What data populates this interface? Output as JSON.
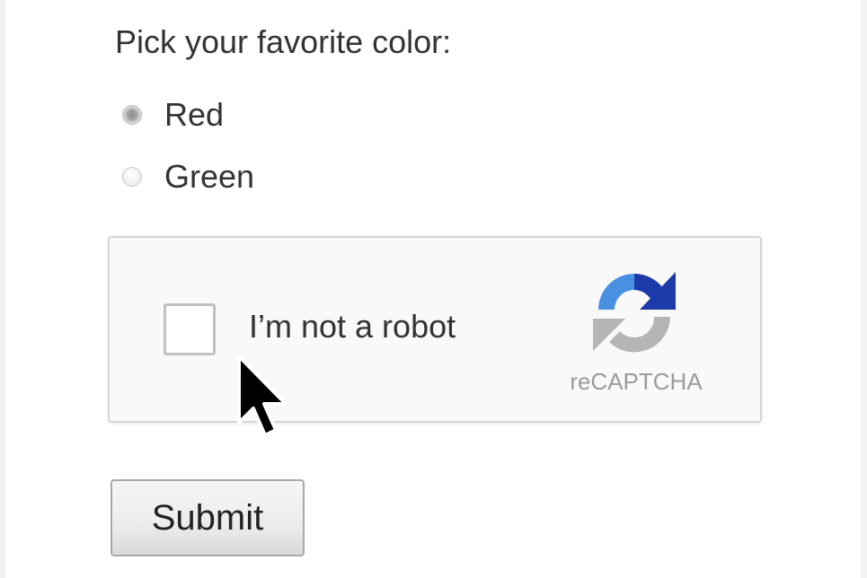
{
  "form": {
    "question": "Pick your favorite color:",
    "options": [
      {
        "label": "Red",
        "checked": true
      },
      {
        "label": "Green",
        "checked": false
      }
    ],
    "submit_label": "Submit"
  },
  "recaptcha": {
    "checkbox_label": "I’m not a robot",
    "checked": false,
    "brand": "reCAPTCHA",
    "icon": "recaptcha-logo-icon",
    "colors": {
      "blue_light": "#4a90e2",
      "blue_dark": "#1c3aa9",
      "gray": "#b5b5b5"
    }
  },
  "cursor": {
    "icon": "mouse-pointer-icon"
  }
}
